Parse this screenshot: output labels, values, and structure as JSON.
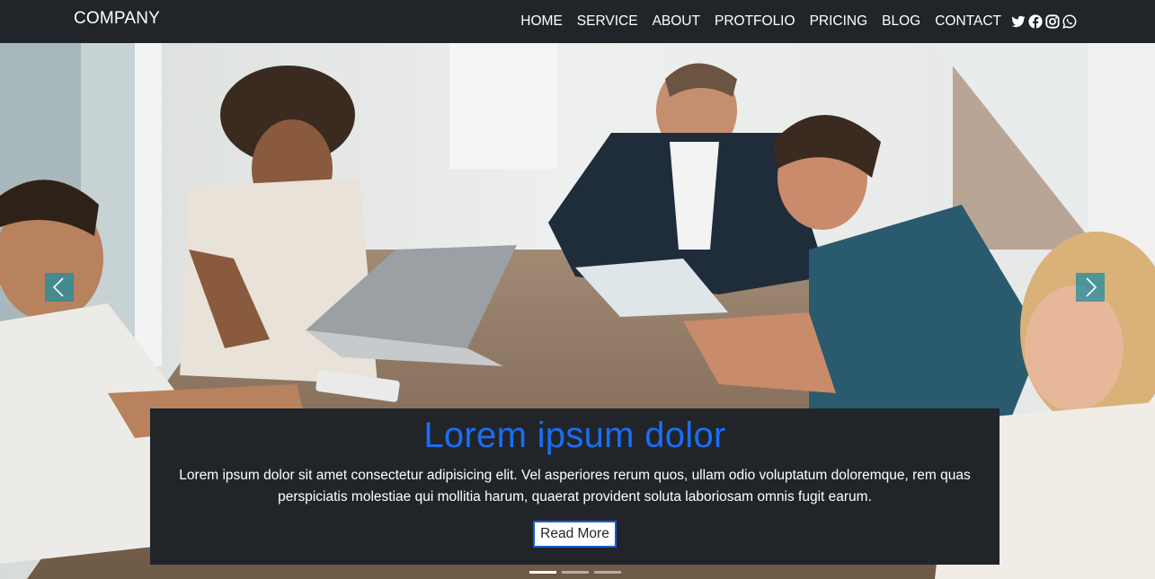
{
  "navbar": {
    "brand": "COMPANY",
    "links": [
      "HOME",
      "SERVICE",
      "ABOUT",
      "PROTFOLIO",
      "PRICING",
      "BLOG",
      "CONTACT"
    ],
    "social_icons": [
      "twitter-icon",
      "facebook-icon",
      "instagram-icon",
      "whatsapp-icon"
    ]
  },
  "hero": {
    "image": "business-team-meeting-photo",
    "caption": {
      "title": "Lorem ipsum dolor",
      "text": "Lorem ipsum dolor sit amet consectetur adipisicing elit. Vel asperiores rerum quos, ullam odio voluptatum doloremque, rem quas perspiciatis molestiae qui mollitia harum, quaerat provident soluta laboriosam omnis fugit earum.",
      "button": "Read More"
    },
    "controls": {
      "prev": "chevron-left-icon",
      "next": "chevron-right-icon"
    },
    "slides_total": 3,
    "active_slide": 1
  },
  "colors": {
    "navbar_bg": "#212529",
    "caption_title": "#1a6ef5",
    "control_bg": "#1e8ca0"
  }
}
